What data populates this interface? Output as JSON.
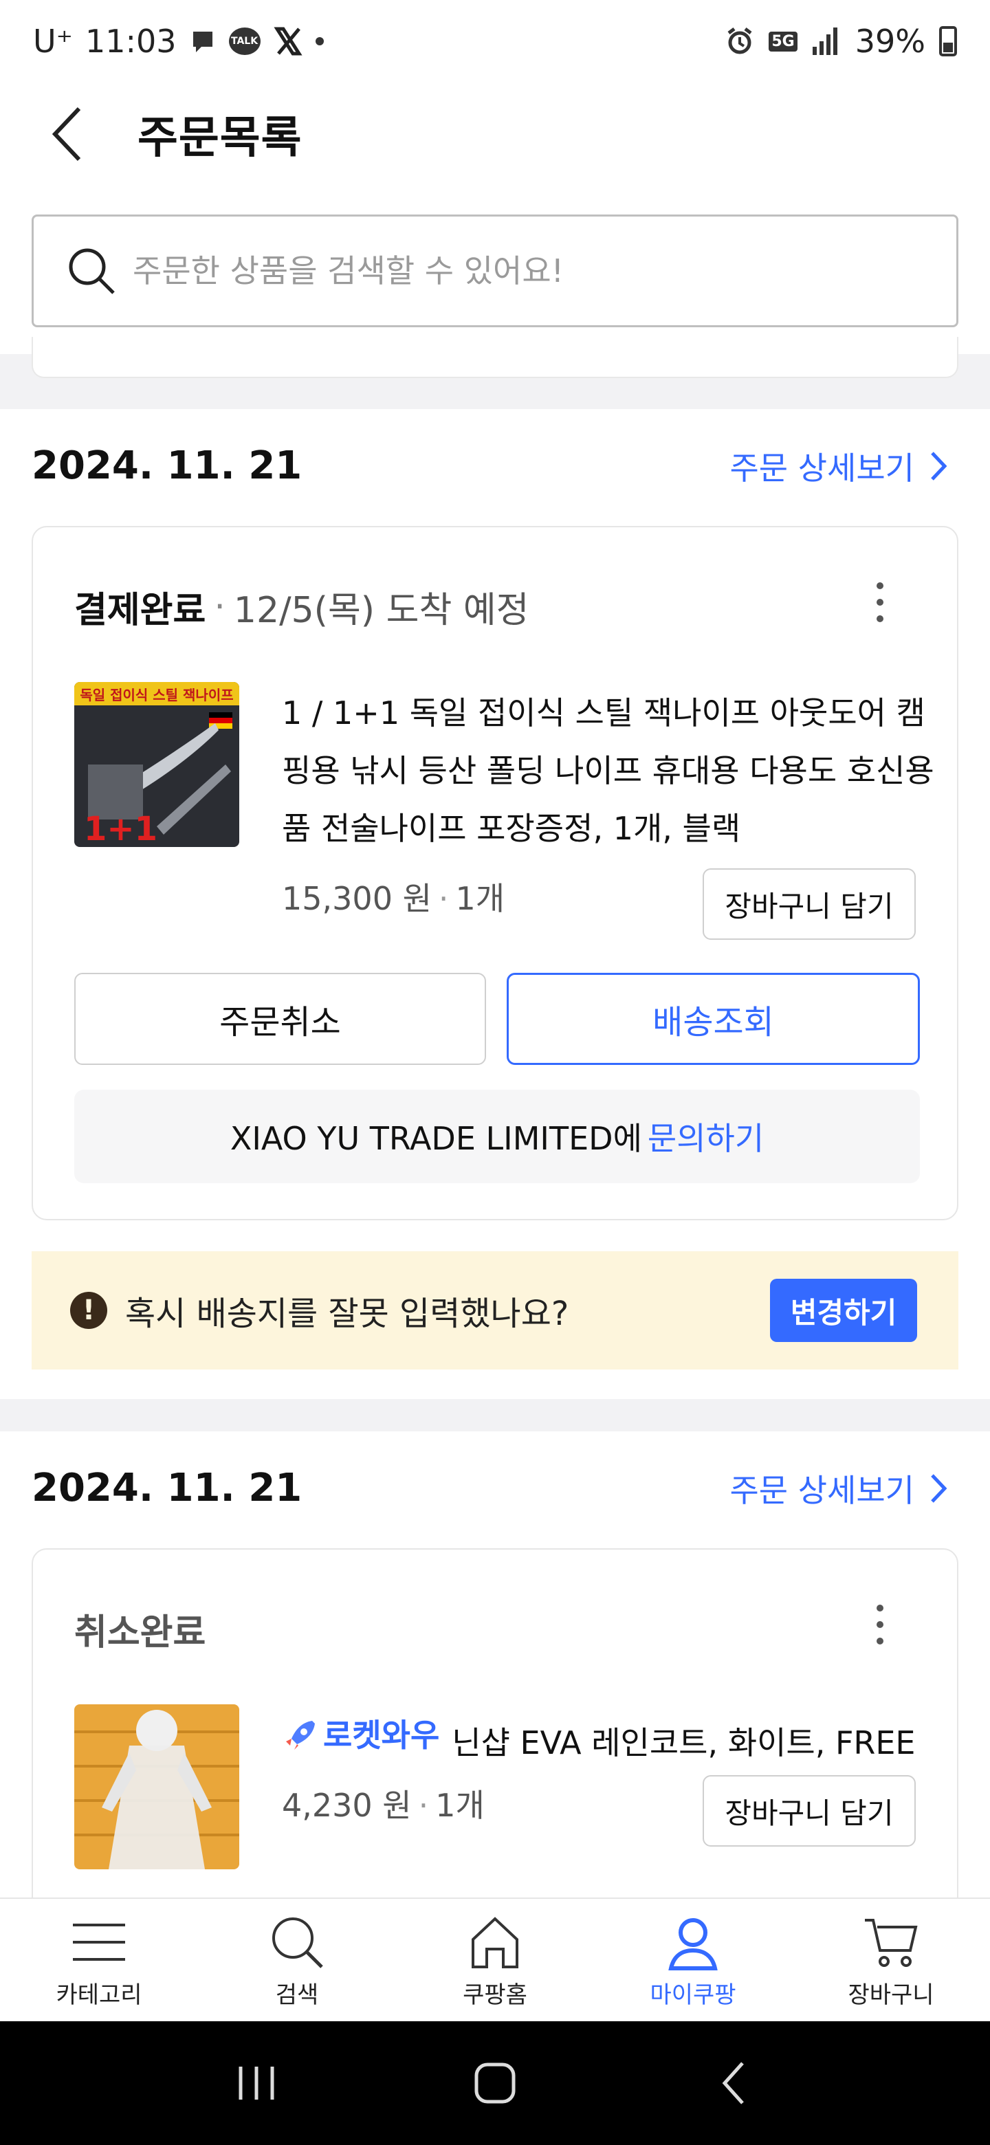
{
  "status_bar": {
    "carrier": "U⁺",
    "time": "11:03",
    "talk_badge": "TALK",
    "network": "5G",
    "battery": "39%"
  },
  "header": {
    "title": "주문목록"
  },
  "search": {
    "placeholder": "주문한 상품을 검색할 수 있어요!"
  },
  "orders": [
    {
      "date": "2024. 11. 21",
      "detail_label": "주문 상세보기",
      "status": "결제완료",
      "status_separator": "·",
      "delivery": "12/5(목) 도착 예정",
      "product": {
        "title": "1 / 1+1 독일 접이식 스틸 잭나이프 아웃도어 캠핑용 낚시 등산 폴딩 나이프 휴대용 다용도 호신용품 전술나이프 포장증정, 1개, 블랙",
        "price": "15,300 원",
        "qty": "1개",
        "thumb_text": "독일 접이식 스틸 잭나이프",
        "thumb_promo": "1+1"
      },
      "cart_label": "장바구니 담기",
      "cancel_label": "주문취소",
      "track_label": "배송조회",
      "seller": "XIAO YU TRADE LIMITED에",
      "inquiry_label": "문의하기",
      "alert": {
        "text": "혹시 배송지를 잘못 입력했나요?",
        "button": "변경하기"
      }
    },
    {
      "date": "2024. 11. 21",
      "detail_label": "주문 상세보기",
      "status": "취소완료",
      "product": {
        "badge": "로켓와우",
        "title": "닌샵 EVA 레인코트, 화이트, FREE",
        "price": "4,230 원",
        "qty": "1개"
      },
      "cart_label": "장바구니 담기"
    }
  ],
  "bottom_nav": [
    {
      "label": "카테고리",
      "icon": "menu-icon"
    },
    {
      "label": "검색",
      "icon": "search-icon"
    },
    {
      "label": "쿠팡홈",
      "icon": "home-icon"
    },
    {
      "label": "마이쿠팡",
      "icon": "person-icon",
      "active": true
    },
    {
      "label": "장바구니",
      "icon": "cart-icon"
    }
  ],
  "colors": {
    "accent": "#346aff",
    "alert_bg": "#fdf5dc"
  }
}
